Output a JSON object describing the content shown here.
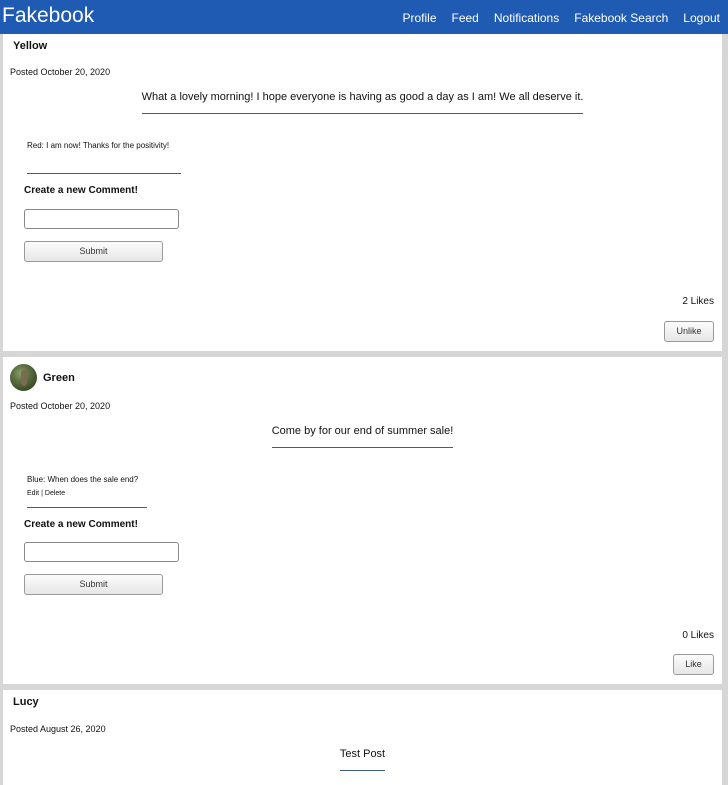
{
  "app": {
    "brand": "Fakebook"
  },
  "nav": {
    "items": [
      "Profile",
      "Feed",
      "Notifications",
      "Fakebook Search",
      "Logout"
    ]
  },
  "posts": [
    {
      "author": "Yellow",
      "has_avatar": false,
      "date": "Posted October 20, 2020",
      "content": "What a lovely morning! I hope everyone is having as good a day as I am! We all deserve it.",
      "comments": [
        {
          "text": "Red: I am now! Thanks for the positivity!"
        }
      ],
      "new_comment_label": "Create a new Comment!",
      "submit_label": "Submit",
      "likes": "2 Likes",
      "like_button": "Unlike"
    },
    {
      "author": "Green",
      "has_avatar": true,
      "date": "Posted October 20, 2020",
      "content": "Come by for our end of summer sale!",
      "comments": [
        {
          "text": "Blue: When does the sale end?",
          "edit": "Edit",
          "delete": "Delete",
          "sep": "|"
        }
      ],
      "new_comment_label": "Create a new Comment!",
      "submit_label": "Submit",
      "likes": "0 Likes",
      "like_button": "Like"
    },
    {
      "author": "Lucy",
      "has_avatar": false,
      "date": "Posted August 26, 2020",
      "content": "Test Post"
    }
  ]
}
